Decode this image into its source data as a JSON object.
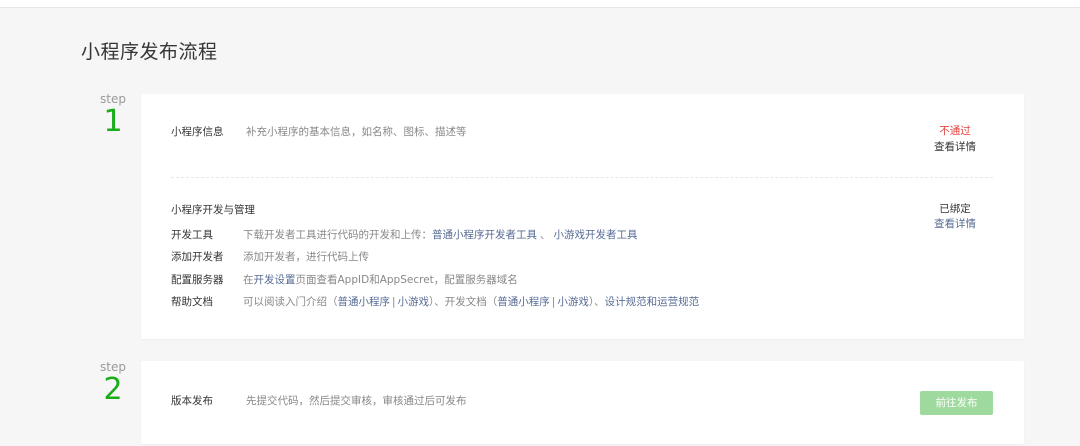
{
  "page": {
    "title": "小程序发布流程"
  },
  "steps": [
    {
      "label": "step",
      "number": "1"
    },
    {
      "label": "step",
      "number": "2"
    }
  ],
  "step1": {
    "info": {
      "label": "小程序信息",
      "desc": "补充小程序的基本信息，如名称、图标、描述等",
      "status": "不通过",
      "detail_link": "查看详情"
    },
    "dev": {
      "title": "小程序开发与管理",
      "status": "已绑定",
      "detail_link": "查看详情",
      "rows": {
        "tools": {
          "label": "开发工具",
          "text": "下载开发者工具进行代码的开发和上传：",
          "link1": "普通小程序开发者工具",
          "sep": "、",
          "link2": "小游戏开发者工具"
        },
        "add_dev": {
          "label": "添加开发者",
          "text": "添加开发者，进行代码上传"
        },
        "server": {
          "label": "配置服务器",
          "pre": "在",
          "link": "开发设置",
          "text": "页面查看AppID和AppSecret，配置服务器域名"
        },
        "docs": {
          "label": "帮助文档",
          "t1": "可以阅读入门介绍（",
          "l1": "普通小程序",
          "bar1": "|",
          "l2": "小游戏",
          "t2": "）、开发文档（",
          "l3": "普通小程序",
          "bar2": "|",
          "l4": "小游戏",
          "t3": "）、",
          "l5": "设计规范",
          "t4": "和",
          "l6": "运营规范"
        }
      }
    }
  },
  "step2": {
    "label": "版本发布",
    "desc": "先提交代码，然后提交审核，审核通过后可发布",
    "button": "前往发布"
  },
  "colors": {
    "accent_green": "#1aad19",
    "disabled_button": "#9ed99d",
    "link": "#576b95",
    "error": "#e64340"
  }
}
